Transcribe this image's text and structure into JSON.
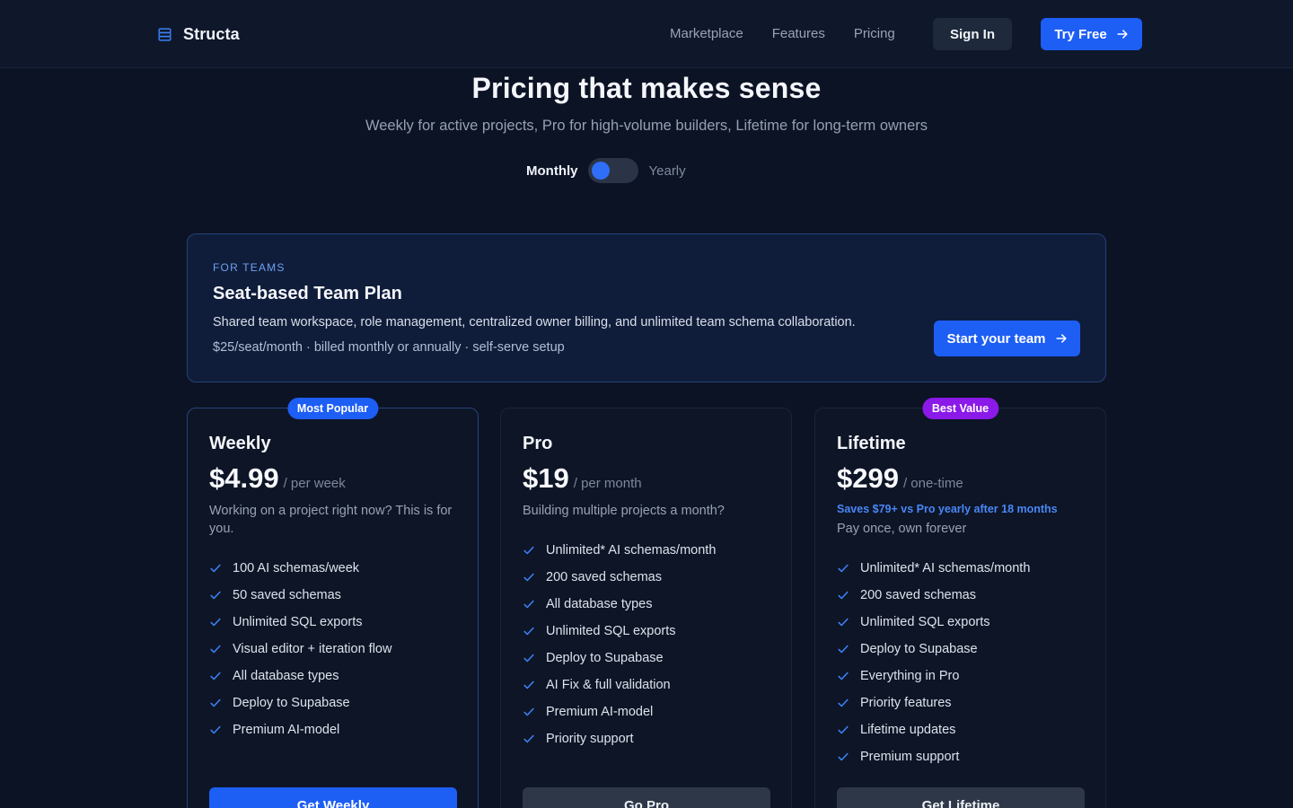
{
  "nav": {
    "brand": "Structa",
    "links": [
      "Marketplace",
      "Features",
      "Pricing"
    ],
    "sign_in": "Sign In",
    "try_free": "Try Free"
  },
  "hero": {
    "title": "Pricing that makes sense",
    "subtitle": "Weekly for active projects, Pro for high-volume builders, Lifetime for long-term owners",
    "toggle": {
      "monthly": "Monthly",
      "yearly": "Yearly",
      "selected": "Monthly"
    }
  },
  "team": {
    "eyebrow": "FOR TEAMS",
    "title": "Seat-based Team Plan",
    "description": "Shared team workspace, role management, centralized owner billing, and unlimited team schema collaboration.",
    "price_line": "$25/seat/month · billed monthly or annually · self-serve setup",
    "cta": "Start your team"
  },
  "plans": [
    {
      "badge": "Most Popular",
      "name": "Weekly",
      "price": "$4.99",
      "period": "/ per week",
      "tagline": "Working on a project right now? This is for you.",
      "features": [
        "100 AI schemas/week",
        "50 saved schemas",
        "Unlimited SQL exports",
        "Visual editor + iteration flow",
        "All database types",
        "Deploy to Supabase",
        "Premium AI-model"
      ],
      "cta": "Get Weekly"
    },
    {
      "name": "Pro",
      "price": "$19",
      "period": "/ per month",
      "tagline": "Building multiple projects a month?",
      "features": [
        "Unlimited* AI schemas/month",
        "200 saved schemas",
        "All database types",
        "Unlimited SQL exports",
        "Deploy to Supabase",
        "AI Fix & full validation",
        "Premium AI-model",
        "Priority support"
      ],
      "cta": "Go Pro"
    },
    {
      "badge": "Best Value",
      "name": "Lifetime",
      "price": "$299",
      "period": "/ one-time",
      "saves": "Saves $79+ vs Pro yearly after 18 months",
      "tagline": "Pay once, own forever",
      "features": [
        "Unlimited* AI schemas/month",
        "200 saved schemas",
        "Unlimited SQL exports",
        "Deploy to Supabase",
        "Everything in Pro",
        "Priority features",
        "Lifetime updates",
        "Premium support"
      ],
      "cta": "Get Lifetime"
    }
  ],
  "colors": {
    "background": "#0c1324",
    "accent": "#1d5ef5",
    "badge_purple": "#8b19e8",
    "check": "#3b82f6"
  },
  "icons": {
    "brand": "database-icon",
    "arrow": "arrow-right-icon",
    "check": "check-icon"
  }
}
